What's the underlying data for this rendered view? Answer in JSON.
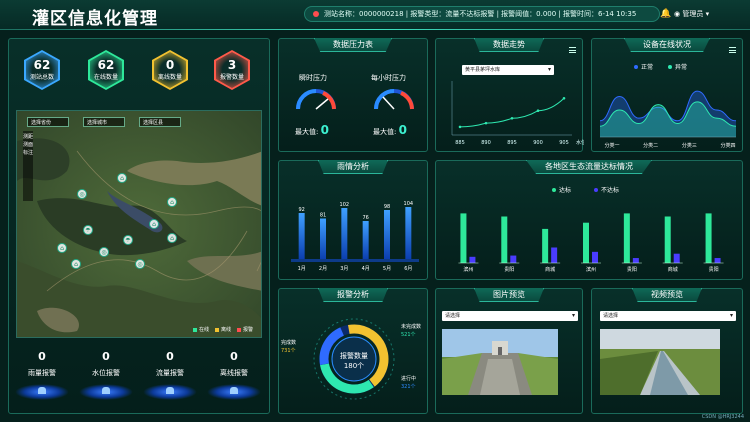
{
  "header": {
    "title": "灌区信息化管理",
    "alarm": "测站名称：0000000218 | 报警类型：流量不达标报警 | 报警阈值：0.000 | 报警时间：6-14 10:35",
    "bell_icon": "bell-icon",
    "user": "管理员"
  },
  "hex_stats": [
    {
      "value": "62",
      "label": "测站总数",
      "color": "#3aa8ff"
    },
    {
      "value": "62",
      "label": "在线数量",
      "color": "#2ee89a"
    },
    {
      "value": "0",
      "label": "离线数量",
      "color": "#f2c230"
    },
    {
      "value": "3",
      "label": "报警数量",
      "color": "#ff5a4a"
    }
  ],
  "map": {
    "selects": [
      "选择省份",
      "选择城市",
      "选择区县"
    ],
    "tools": [
      "测距",
      "测面",
      "标注"
    ],
    "legend": [
      {
        "label": "在线",
        "color": "#2ee89a"
      },
      {
        "label": "离线",
        "color": "#f2c230"
      },
      {
        "label": "报警",
        "color": "#ff4d4f"
      }
    ]
  },
  "bottom_stats": [
    {
      "value": "0",
      "label": "雨量报警"
    },
    {
      "value": "0",
      "label": "水位报警"
    },
    {
      "value": "0",
      "label": "流量报警"
    },
    {
      "value": "0",
      "label": "离线报警"
    }
  ],
  "pressure": {
    "title": "数据压力表",
    "gauges": [
      {
        "label": "瞬时压力",
        "max_label": "最大值:",
        "value": "0"
      },
      {
        "label": "每小时压力",
        "max_label": "最大值:",
        "value": "0"
      }
    ]
  },
  "trend": {
    "title": "数据走势",
    "select": "黄平县茅坪水库",
    "chart_data": {
      "type": "line",
      "x": [
        885,
        890,
        895,
        900,
        905
      ],
      "xlabel": "水位",
      "series": [
        {
          "values": [
            0.15,
            0.22,
            0.31,
            0.45,
            0.68
          ]
        }
      ]
    },
    "menu_icon": "menu-icon"
  },
  "online": {
    "title": "设备在线状况",
    "chart_data": {
      "type": "area",
      "categories": [
        "分类一",
        "分类二",
        "分类三",
        "分类四"
      ],
      "series": [
        {
          "name": "正常",
          "color": "#2f6bff",
          "values": [
            0.3,
            0.75,
            0.35,
            0.55,
            0.3,
            0.85,
            0.5,
            0.3
          ]
        },
        {
          "name": "异常",
          "color": "#2ee8b0",
          "values": [
            0.2,
            0.5,
            0.25,
            0.6,
            0.25,
            0.65,
            0.35,
            0.2
          ]
        }
      ]
    },
    "menu_icon": "menu-icon"
  },
  "rain": {
    "title": "雨情分析",
    "chart_data": {
      "type": "bar",
      "categories": [
        "1月",
        "2月",
        "3月",
        "4月",
        "5月",
        "6月"
      ],
      "values": [
        92,
        81,
        102,
        76,
        98,
        104
      ]
    }
  },
  "eco": {
    "title": "各地区生态流量达标情况",
    "chart_data": {
      "type": "bar",
      "categories": [
        "滨州",
        "贵阳",
        "商城",
        "滨州",
        "贵阳",
        "商城",
        "贵阳"
      ],
      "series": [
        {
          "name": "达标",
          "color": "#2ee89a",
          "values": [
            80,
            75,
            55,
            65,
            80,
            75,
            80
          ]
        },
        {
          "name": "不达标",
          "color": "#4a3cff",
          "values": [
            10,
            12,
            25,
            18,
            8,
            15,
            8
          ]
        }
      ]
    }
  },
  "alarm_analysis": {
    "title": "报警分析",
    "center_label": "报警数量",
    "center_value": "180个",
    "items": [
      {
        "label": "完成数",
        "value": "731个"
      },
      {
        "label": "未完成数",
        "value": "521个"
      },
      {
        "label": "进行中",
        "value": "321个"
      }
    ]
  },
  "image_preview": {
    "title": "图片预览",
    "select": "请选择"
  },
  "video_preview": {
    "title": "视频预览",
    "select": "请选择"
  },
  "footer": "CSDN @HRJ3244"
}
